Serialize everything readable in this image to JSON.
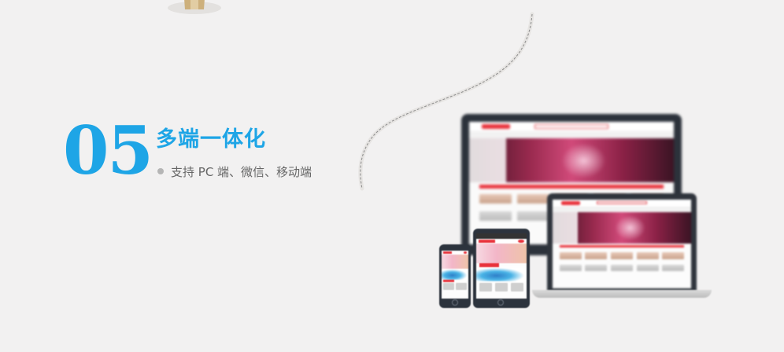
{
  "section": {
    "number": "05",
    "title": "多端一体化",
    "subtitle": "支持 PC 端、微信、移动端"
  },
  "colors": {
    "background": "#f2f1f1",
    "accent": "#1ea5e6",
    "subtitle_text": "#666666",
    "bullet": "#b5b5b5",
    "device_frame": "#2c333d",
    "store_red": "#e8333c"
  },
  "icons": {
    "bullet": "bullet-dot-icon",
    "top_decoration": "lamp-base-icon"
  },
  "illustration": {
    "devices": [
      "desktop-monitor",
      "laptop",
      "tablet",
      "smartphone"
    ]
  }
}
